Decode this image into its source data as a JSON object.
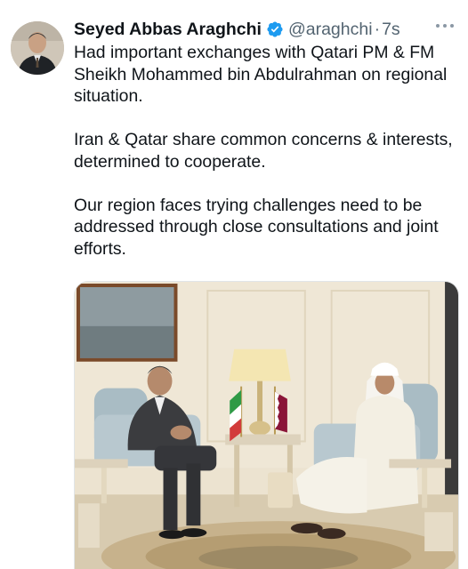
{
  "tweet": {
    "author_name": "Seyed Abbas Araghchi",
    "handle": "@araghchi",
    "separator": "·",
    "timestamp": "7s",
    "paragraphs": [
      "Had important exchanges with Qatari PM & FM Sheikh Mohammed bin Abdulrahman on regional situation.",
      "Iran & Qatar share common concerns & interests, determined to cooperate.",
      "Our region faces trying challenges need to be addressed through close consultations and joint efforts."
    ],
    "verified": true
  },
  "icons": {
    "verified": "verified-badge-icon",
    "more": "more-options-icon"
  },
  "colors": {
    "verified_blue": "#1d9bf0",
    "text": "#0f1419",
    "secondary": "#536471"
  }
}
